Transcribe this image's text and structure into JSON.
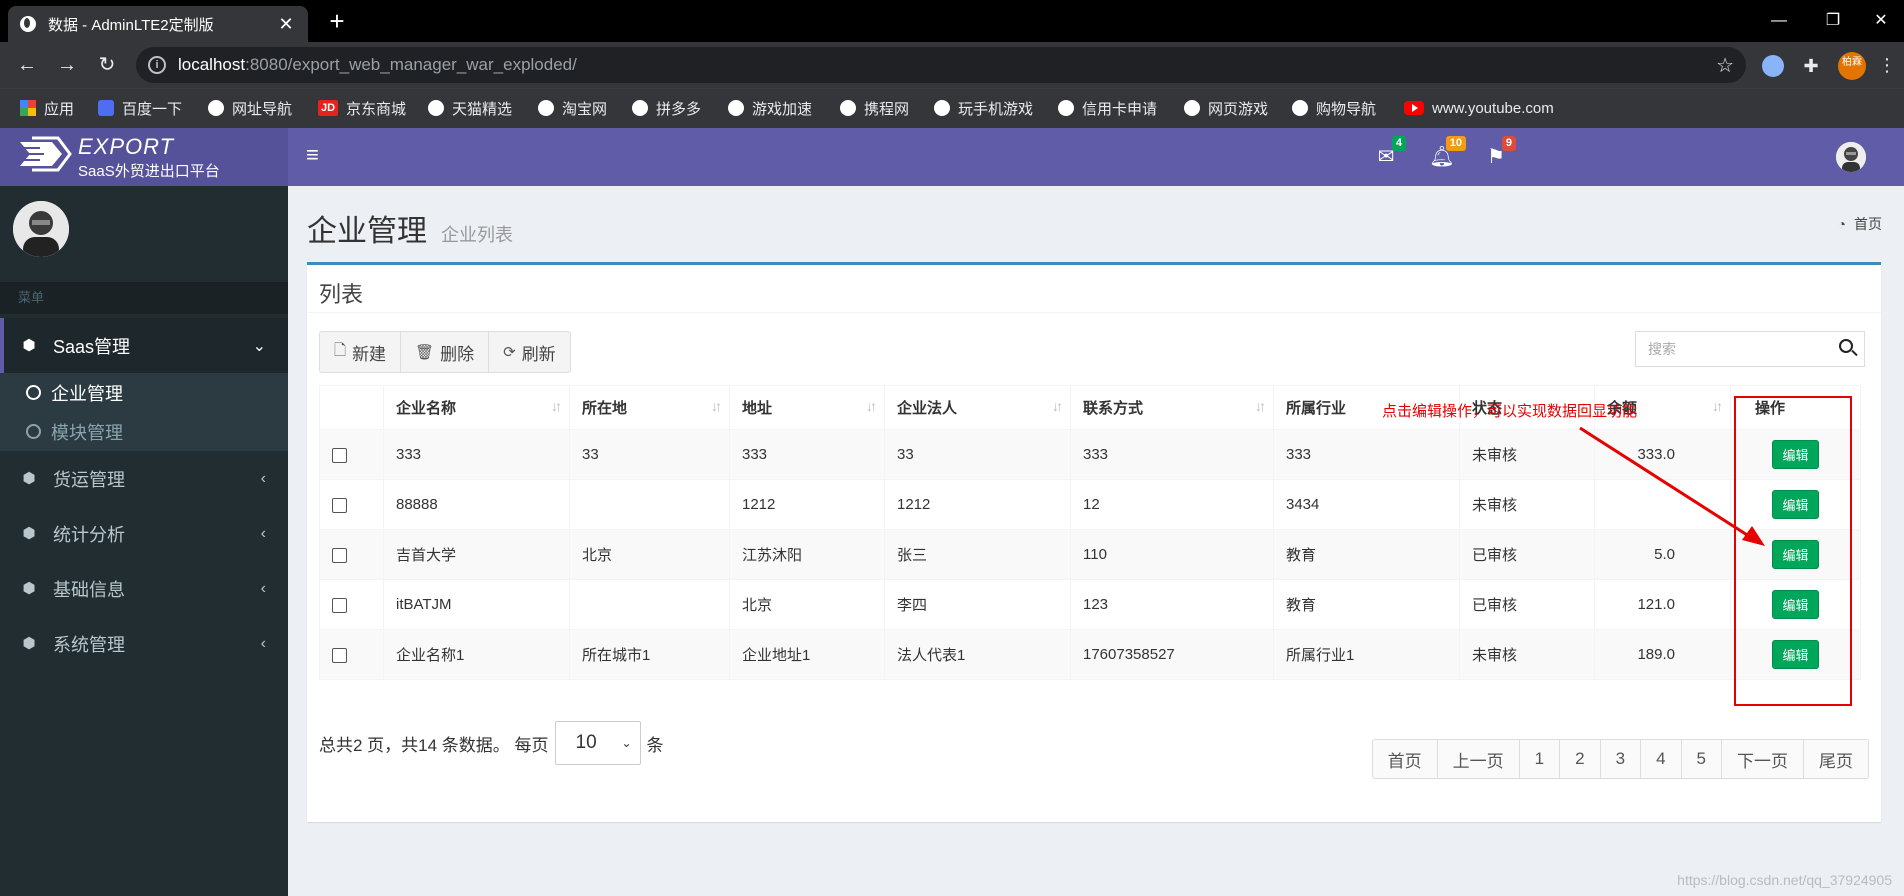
{
  "browser": {
    "tab_title": "数据 - AdminLTE2定制版",
    "new_tab": "+",
    "url_host": "localhost",
    "url_path": ":8080/export_web_manager_war_exploded/",
    "profile_initial": "柏霖",
    "bookmarks": [
      "应用",
      "百度一下",
      "网址导航",
      "京东商城",
      "天猫精选",
      "淘宝网",
      "拼多多",
      "游戏加速",
      "携程网",
      "玩手机游戏",
      "信用卡申请",
      "网页游戏",
      "购物导航",
      "www.youtube.com"
    ]
  },
  "logo": {
    "brand": "EXPORT",
    "subtitle": "SaaS外贸进出口平台"
  },
  "header": {
    "badges": {
      "mail": "4",
      "bell": "10",
      "flag": "9"
    },
    "colors": {
      "mail": "#00a65a",
      "bell": "#f39c12",
      "flag": "#dd4b39"
    }
  },
  "sidebar": {
    "menu_header": "菜单",
    "items": [
      {
        "label": "Saas管理",
        "icon": "cube-icon"
      },
      {
        "label": "货运管理",
        "icon": "cube-icon"
      },
      {
        "label": "统计分析",
        "icon": "cube-icon"
      },
      {
        "label": "基础信息",
        "icon": "cube-icon"
      },
      {
        "label": "系统管理",
        "icon": "cube-icon"
      }
    ],
    "sub_items": [
      {
        "label": "企业管理"
      },
      {
        "label": "模块管理"
      }
    ]
  },
  "page": {
    "title": "企业管理",
    "subtitle": "企业列表",
    "breadcrumb": "首页",
    "box_title": "列表",
    "buttons": {
      "new": "新建",
      "delete": "删除",
      "refresh": "刷新"
    },
    "search_placeholder": "搜索"
  },
  "table": {
    "headers": [
      "企业名称",
      "所在地",
      "地址",
      "企业法人",
      "联系方式",
      "所属行业",
      "状态",
      "余额",
      "操作"
    ],
    "rows": [
      {
        "name": "333",
        "city": "33",
        "address": "333",
        "legal": "33",
        "phone": "333",
        "industry": "333",
        "status": "未审核",
        "balance": "333.0",
        "action": "编辑"
      },
      {
        "name": "88888",
        "city": "",
        "address": "1212",
        "legal": "1212",
        "phone": "12",
        "industry": "3434",
        "status": "未审核",
        "balance": "",
        "action": "编辑"
      },
      {
        "name": "吉首大学",
        "city": "北京",
        "address": "江苏沐阳",
        "legal": "张三",
        "phone": "110",
        "industry": "教育",
        "status": "已审核",
        "balance": "5.0",
        "action": "编辑"
      },
      {
        "name": "itBATJM",
        "city": "",
        "address": "北京",
        "legal": "李四",
        "phone": "123",
        "industry": "教育",
        "status": "已审核",
        "balance": "121.0",
        "action": "编辑"
      },
      {
        "name": "企业名称1",
        "city": "所在城市1",
        "address": "企业地址1",
        "legal": "法人代表1",
        "phone": "17607358527",
        "industry": "所属行业1",
        "status": "未审核",
        "balance": "189.0",
        "action": "编辑"
      }
    ]
  },
  "footer": {
    "summary": "总共2 页，共14 条数据。 每页",
    "page_size": "10",
    "unit": "条",
    "pager": [
      "首页",
      "上一页",
      "1",
      "2",
      "3",
      "4",
      "5",
      "下一页",
      "尾页"
    ]
  },
  "annotation": {
    "text": "点击编辑操作，可以实现数据回显功能",
    "color": "#e60000"
  },
  "watermark": "https://blog.csdn.net/qq_37924905"
}
